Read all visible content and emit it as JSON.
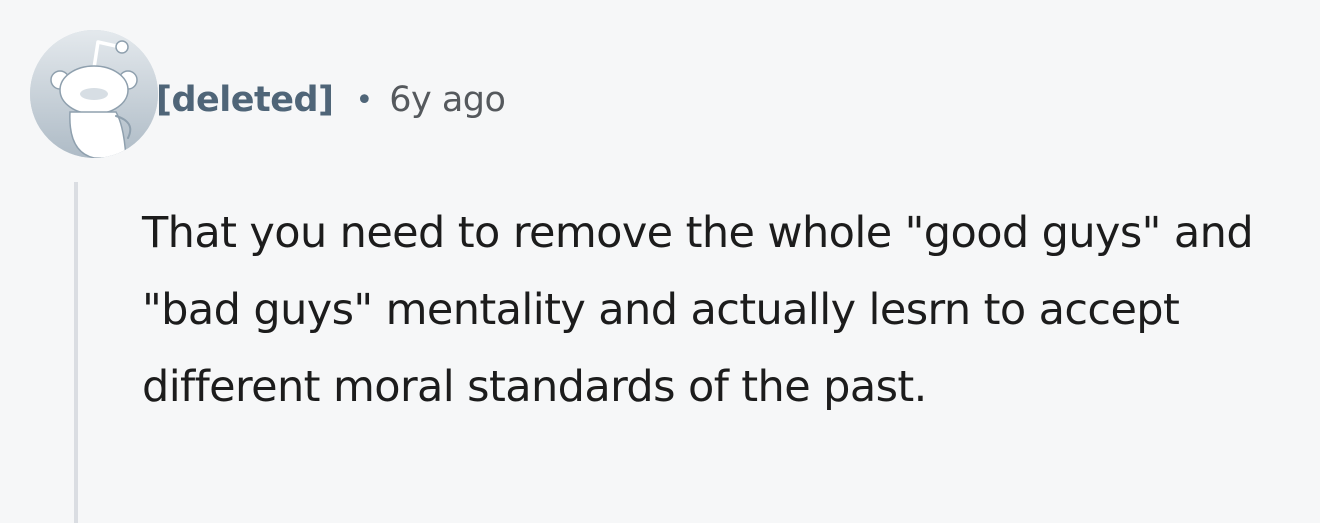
{
  "comment": {
    "author": "[deleted]",
    "separator": "•",
    "timestamp": "6y ago",
    "body": "That you need to remove the whole \"good guys\" and \"bad guys\" mentality and actually lesrn to accept different moral standards of the past."
  },
  "avatar": {
    "icon": "deleted-user-snoo-icon",
    "background_color": "#c8d2db",
    "figure_color": "#ffffff"
  },
  "colors": {
    "page_background": "#f6f7f8",
    "author_text": "#4f6578",
    "meta_text": "#55595d",
    "body_text": "#1c1c1c",
    "thread_line": "#dadde2"
  }
}
